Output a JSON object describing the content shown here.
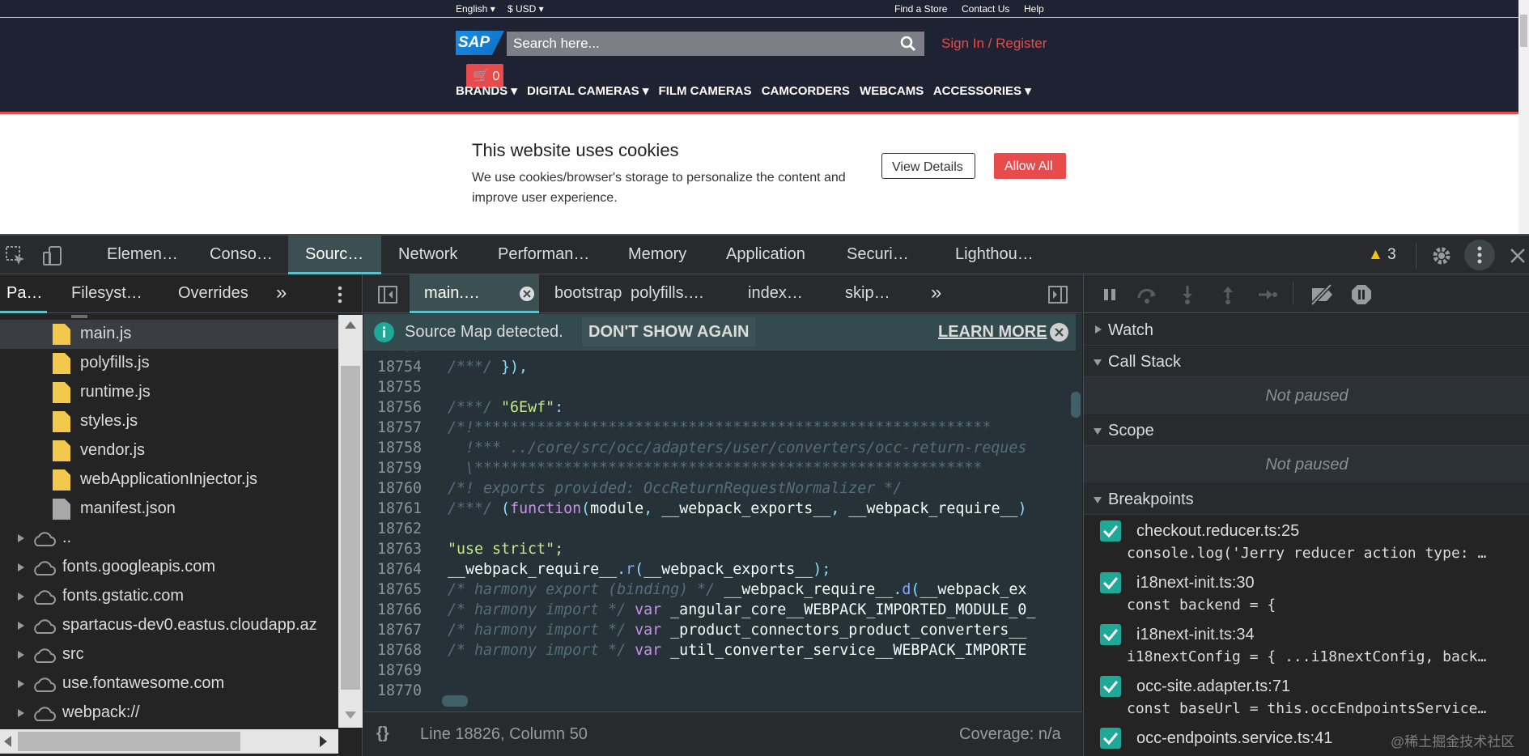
{
  "site": {
    "language": "English",
    "currency": "$ USD",
    "top_links": [
      "Find a Store",
      "Contact Us",
      "Help"
    ],
    "logo": "SAP",
    "search_placeholder": "Search here...",
    "sign_in": "Sign In / Register",
    "cart_count": "0",
    "nav": [
      "BRANDS ▾",
      "DIGITAL CAMERAS ▾",
      "FILM CAMERAS",
      "CAMCORDERS",
      "WEBCAMS",
      "ACCESSORIES ▾"
    ],
    "cookie_title": "This website uses cookies",
    "cookie_text": "We use cookies/browser's storage to personalize the content and improve user experience.",
    "view_details": "View Details",
    "allow_all": "Allow All"
  },
  "devtools": {
    "tabs": [
      "Elemen…",
      "Conso…",
      "Sourc…",
      "Network",
      "Performan…",
      "Memory",
      "Application",
      "Securi…",
      "Lighthou…"
    ],
    "active_tab": "Sourc…",
    "warning_count": "3",
    "nav_tabs": [
      "Pa…",
      "Filesyst…",
      "Overrides"
    ],
    "more_tabs": "»",
    "files": [
      {
        "name": "main.js",
        "type": "js"
      },
      {
        "name": "polyfills.js",
        "type": "js"
      },
      {
        "name": "runtime.js",
        "type": "js"
      },
      {
        "name": "styles.js",
        "type": "js"
      },
      {
        "name": "vendor.js",
        "type": "js"
      },
      {
        "name": "webApplicationInjector.js",
        "type": "js"
      },
      {
        "name": "manifest.json",
        "type": "json"
      }
    ],
    "domains": [
      "..",
      "fonts.googleapis.com",
      "fonts.gstatic.com",
      "spartacus-dev0.eastus.cloudapp.az",
      "src",
      "use.fontawesome.com",
      "webpack://"
    ],
    "editor_tabs": [
      "main.…",
      "bootstrap",
      "polyfills.…",
      "index…",
      "skip…"
    ],
    "source_map": {
      "message": "Source Map detected.",
      "dont_show": "DON'T SHOW AGAIN",
      "learn_more": "LEARN MORE"
    },
    "code_lines": [
      {
        "n": "18754",
        "t": "/***/ }),"
      },
      {
        "n": "18755",
        "t": ""
      },
      {
        "n": "18756",
        "t": "/***/ \"6Ewf\":"
      },
      {
        "n": "18757",
        "t": "/*!**********************************************************"
      },
      {
        "n": "18758",
        "t": "  !*** ../core/src/occ/adapters/user/converters/occ-return-reques"
      },
      {
        "n": "18759",
        "t": "  \\*********************************************************"
      },
      {
        "n": "18760",
        "t": "/*! exports provided: OccReturnRequestNormalizer */"
      },
      {
        "n": "18761",
        "t": "/***/ (function(module, __webpack_exports__, __webpack_require__)"
      },
      {
        "n": "18762",
        "t": ""
      },
      {
        "n": "18763",
        "t": "\"use strict\";"
      },
      {
        "n": "18764",
        "t": "__webpack_require__.r(__webpack_exports__);"
      },
      {
        "n": "18765",
        "t": "/* harmony export (binding) */ __webpack_require__.d(__webpack_ex"
      },
      {
        "n": "18766",
        "t": "/* harmony import */ var _angular_core__WEBPACK_IMPORTED_MODULE_0_"
      },
      {
        "n": "18767",
        "t": "/* harmony import */ var _product_connectors_product_converters__"
      },
      {
        "n": "18768",
        "t": "/* harmony import */ var _util_converter_service__WEBPACK_IMPORTE"
      },
      {
        "n": "18769",
        "t": ""
      },
      {
        "n": "18770",
        "t": ""
      }
    ],
    "status": {
      "format": "{}",
      "position": "Line 18826, Column 50",
      "coverage": "Coverage: n/a"
    },
    "sections": {
      "watch": "Watch",
      "call_stack": "Call Stack",
      "scope": "Scope",
      "breakpoints": "Breakpoints",
      "not_paused": "Not paused"
    },
    "breakpoints": [
      {
        "file": "checkout.reducer.ts:25",
        "code": "console.log('Jerry reducer action type: …"
      },
      {
        "file": "i18next-init.ts:30",
        "code": "const backend = {"
      },
      {
        "file": "i18next-init.ts:34",
        "code": "i18nextConfig = { ...i18nextConfig, back…"
      },
      {
        "file": "occ-site.adapter.ts:71",
        "code": "const baseUrl = this.occEndpointsService…"
      },
      {
        "file": "occ-endpoints.service.ts:41",
        "code": ""
      }
    ],
    "watermark": "@稀土掘金技术社区"
  }
}
